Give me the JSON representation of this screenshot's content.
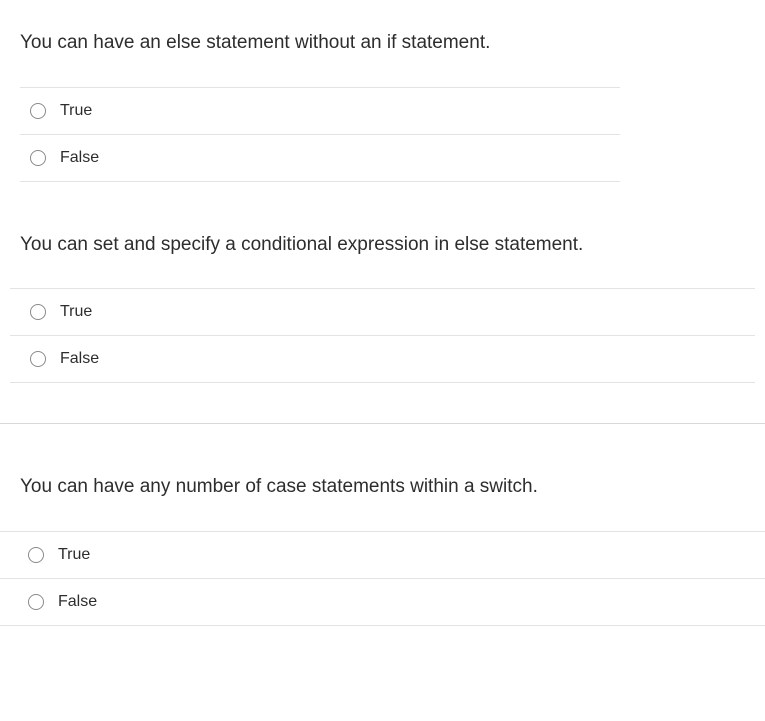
{
  "questions": [
    {
      "prompt": "You can have an else statement without an if statement.",
      "options": [
        "True",
        "False"
      ]
    },
    {
      "prompt": "You can set and specify a conditional expression in else statement.",
      "options": [
        "True",
        "False"
      ]
    },
    {
      "prompt": "You can have any number of case statements within a switch.",
      "options": [
        "True",
        "False"
      ]
    }
  ]
}
